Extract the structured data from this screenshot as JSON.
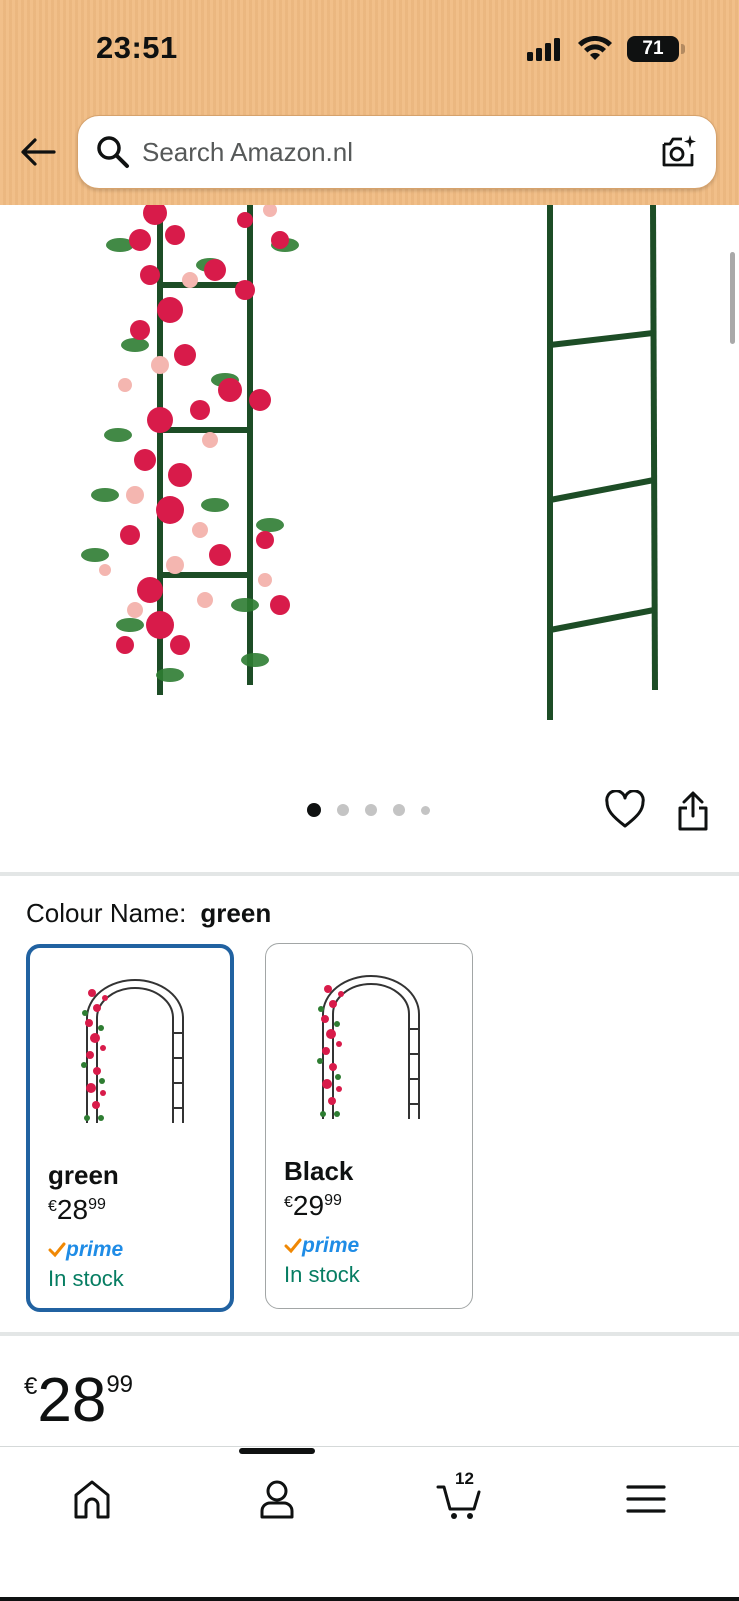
{
  "status_bar": {
    "time": "23:51",
    "battery": "71"
  },
  "search": {
    "placeholder": "Search Amazon.nl"
  },
  "gallery": {
    "page_count": 5,
    "active_index": 0
  },
  "variation": {
    "label": "Colour Name:",
    "selected": "green",
    "options": [
      {
        "name": "green",
        "currency": "€",
        "whole": "28",
        "fraction": "99",
        "prime": "prime",
        "stock": "In stock",
        "selected": true
      },
      {
        "name": "Black",
        "currency": "€",
        "whole": "29",
        "fraction": "99",
        "prime": "prime",
        "stock": "In stock",
        "selected": false
      }
    ]
  },
  "price": {
    "currency": "€",
    "whole": "28",
    "fraction": "99"
  },
  "tabbar": {
    "items": [
      "home-icon",
      "account-icon",
      "cart-icon",
      "menu-icon"
    ],
    "cart_count": "12"
  },
  "colors": {
    "header": "#f0bb82",
    "selected_border": "#2162a1",
    "stock_green": "#067d62",
    "prime_blue": "#1f8ce6",
    "prime_check": "#f08804"
  }
}
